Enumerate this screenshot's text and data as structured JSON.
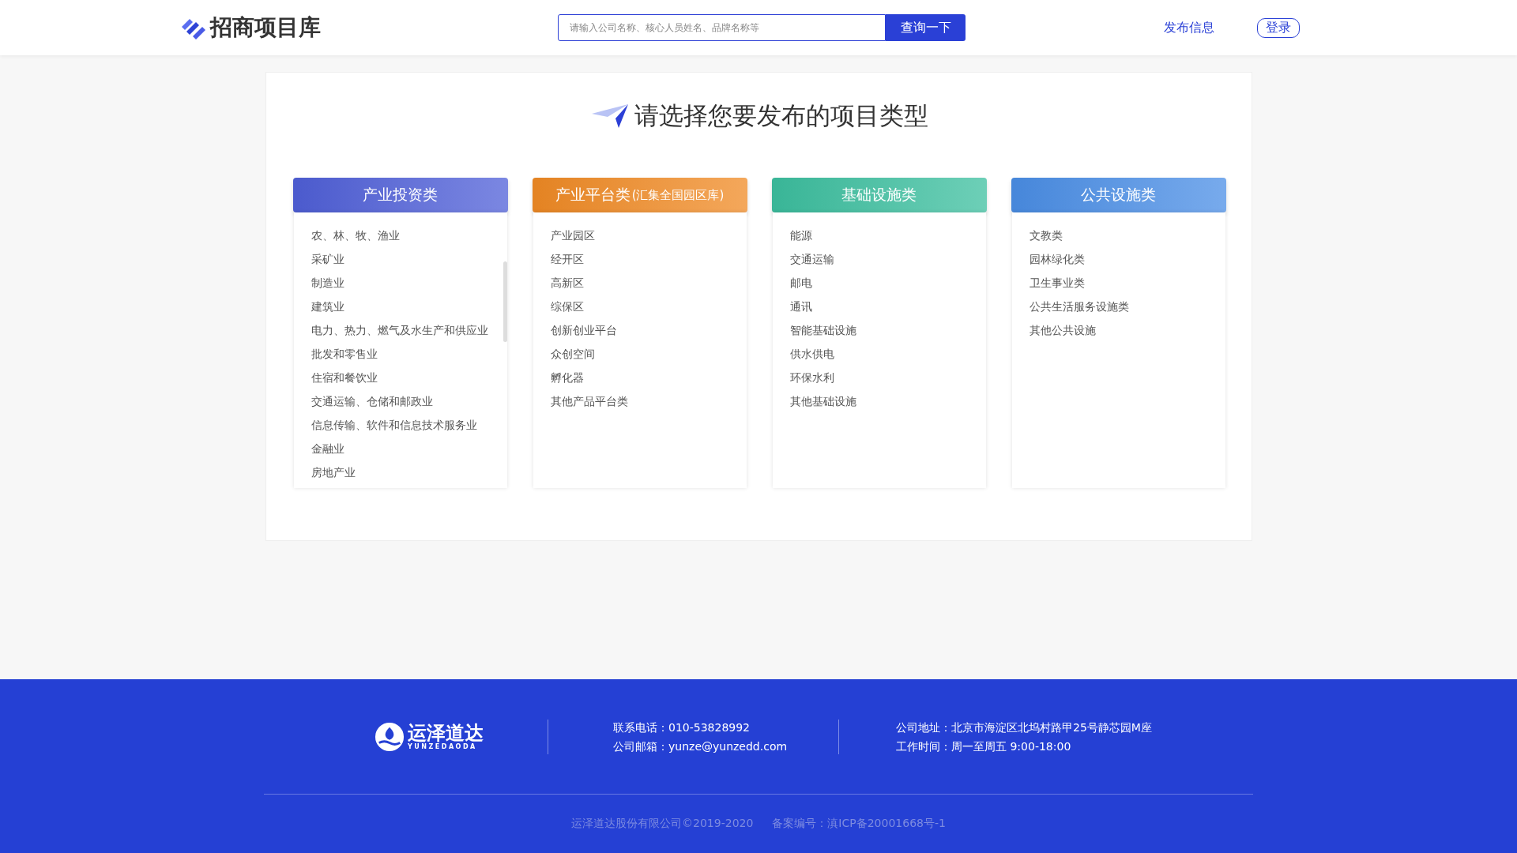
{
  "header": {
    "logo_text": "招商项目库",
    "search": {
      "placeholder": "请输入公司名称、核心人员姓名、品牌名称等",
      "button": "查询一下"
    },
    "publish_link": "发布信息",
    "login_button": "登录"
  },
  "main": {
    "title": "请选择您要发布的项目类型",
    "categories": [
      {
        "title": "产业投资类",
        "color": "#4f5fd8",
        "scrollable": true,
        "items": [
          "农、林、牧、渔业",
          "采矿业",
          "制造业",
          "建筑业",
          "电力、热力、燃气及水生产和供应业",
          "批发和零售业",
          "住宿和餐饮业",
          "交通运输、仓储和邮政业",
          "信息传输、软件和信息技术服务业",
          "金融业",
          "房地产业"
        ]
      },
      {
        "title": "产业平台类",
        "subtitle": "(汇集全国园区库)",
        "color": "#f08a24",
        "scrollable": false,
        "items": [
          "产业园区",
          "经开区",
          "高新区",
          "综保区",
          "创新创业平台",
          "众创空间",
          "孵化器",
          "其他产品平台类"
        ]
      },
      {
        "title": "基础设施类",
        "color": "#3cbf9f",
        "scrollable": false,
        "items": [
          "能源",
          "交通运输",
          "邮电",
          "通讯",
          "智能基础设施",
          "供水供电",
          "环保水利",
          "其他基础设施"
        ]
      },
      {
        "title": "公共设施类",
        "color": "#4a8ee6",
        "scrollable": false,
        "items": [
          "文教类",
          "园林绿化类",
          "卫生事业类",
          "公共生活服务设施类",
          "其他公共设施"
        ]
      }
    ]
  },
  "footer": {
    "brand": "运泽道达",
    "brand_latin": "YUNZEDAODA",
    "contacts": [
      [
        "联系电话：010-53828992",
        "公司邮箱：yunze@yunzedd.com"
      ],
      [
        "公司地址：北京市海淀区北坞村路甲25号静芯园M座",
        "工作时间：周一至周五  9:00-18:00"
      ]
    ],
    "copyright": "运泽道达股份有限公司©2019-2020",
    "icp": "备案编号：滇ICP备20001668号-1"
  }
}
